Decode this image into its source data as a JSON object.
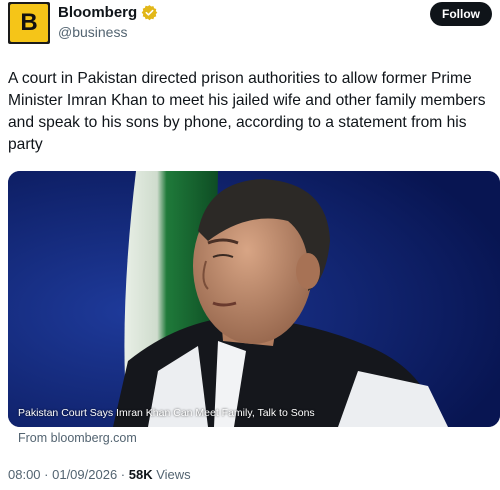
{
  "account": {
    "name": "Bloomberg",
    "handle": "@business",
    "logo_letter": "B",
    "verified_icon": "verified-badge-icon",
    "brand_color": "#f5c518"
  },
  "follow_label": "Follow",
  "tweet": {
    "text": "A court in Pakistan directed prison authorities to allow former Prime Minister Imran Khan to meet his jailed wife and other family members and speak to his sons by phone, according to a statement from his party"
  },
  "media": {
    "caption": "Pakistan Court Says Imran Khan Can Meet Family, Talk to Sons",
    "source": "From bloomberg.com"
  },
  "meta": {
    "time": "08:00",
    "separator1": " · ",
    "date": "01/09/2026",
    "separator2": " · ",
    "views_count": "58K",
    "views_label": " Views"
  }
}
